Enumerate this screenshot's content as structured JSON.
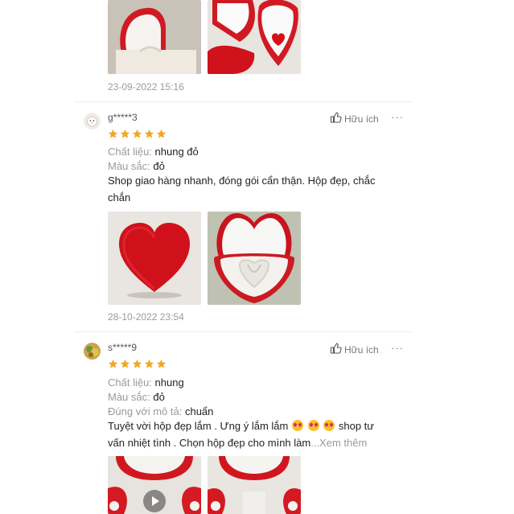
{
  "reviews": [
    {
      "date": "23-09-2022 15:16"
    },
    {
      "username": "g*****3",
      "helpful_label": "Hữu ích",
      "more_label": "···",
      "rating": 5,
      "attributes": [
        {
          "label": "Chất liệu:",
          "value": "nhung đỏ"
        },
        {
          "label": "Màu sắc:",
          "value": "đỏ"
        }
      ],
      "content_line1": "Shop giao hàng nhanh, đóng gói cẩn thận. Hộp đẹp, chắc",
      "content_line2": "chắn",
      "date": "28-10-2022 23:54"
    },
    {
      "username": "s*****9",
      "helpful_label": "Hữu ích",
      "more_label": "···",
      "rating": 5,
      "attributes": [
        {
          "label": "Chất liệu:",
          "value": "nhung"
        },
        {
          "label": "Màu sắc:",
          "value": "đỏ"
        },
        {
          "label": "Đúng với mô tả:",
          "value": "chuẩn"
        }
      ],
      "content_line1_a": "Tuyệt vời hộp đẹp lắm . Ưng ý lắm lắm",
      "content_line1_b": "shop tư",
      "content_line2": "vấn nhiệt tình . Chọn hộp đẹp cho mình làm",
      "see_more": "...Xem thêm"
    }
  ],
  "colors": {
    "star": "#f5a623",
    "velvet_red": "#d8161f",
    "muted_text": "#9a9a9a"
  }
}
